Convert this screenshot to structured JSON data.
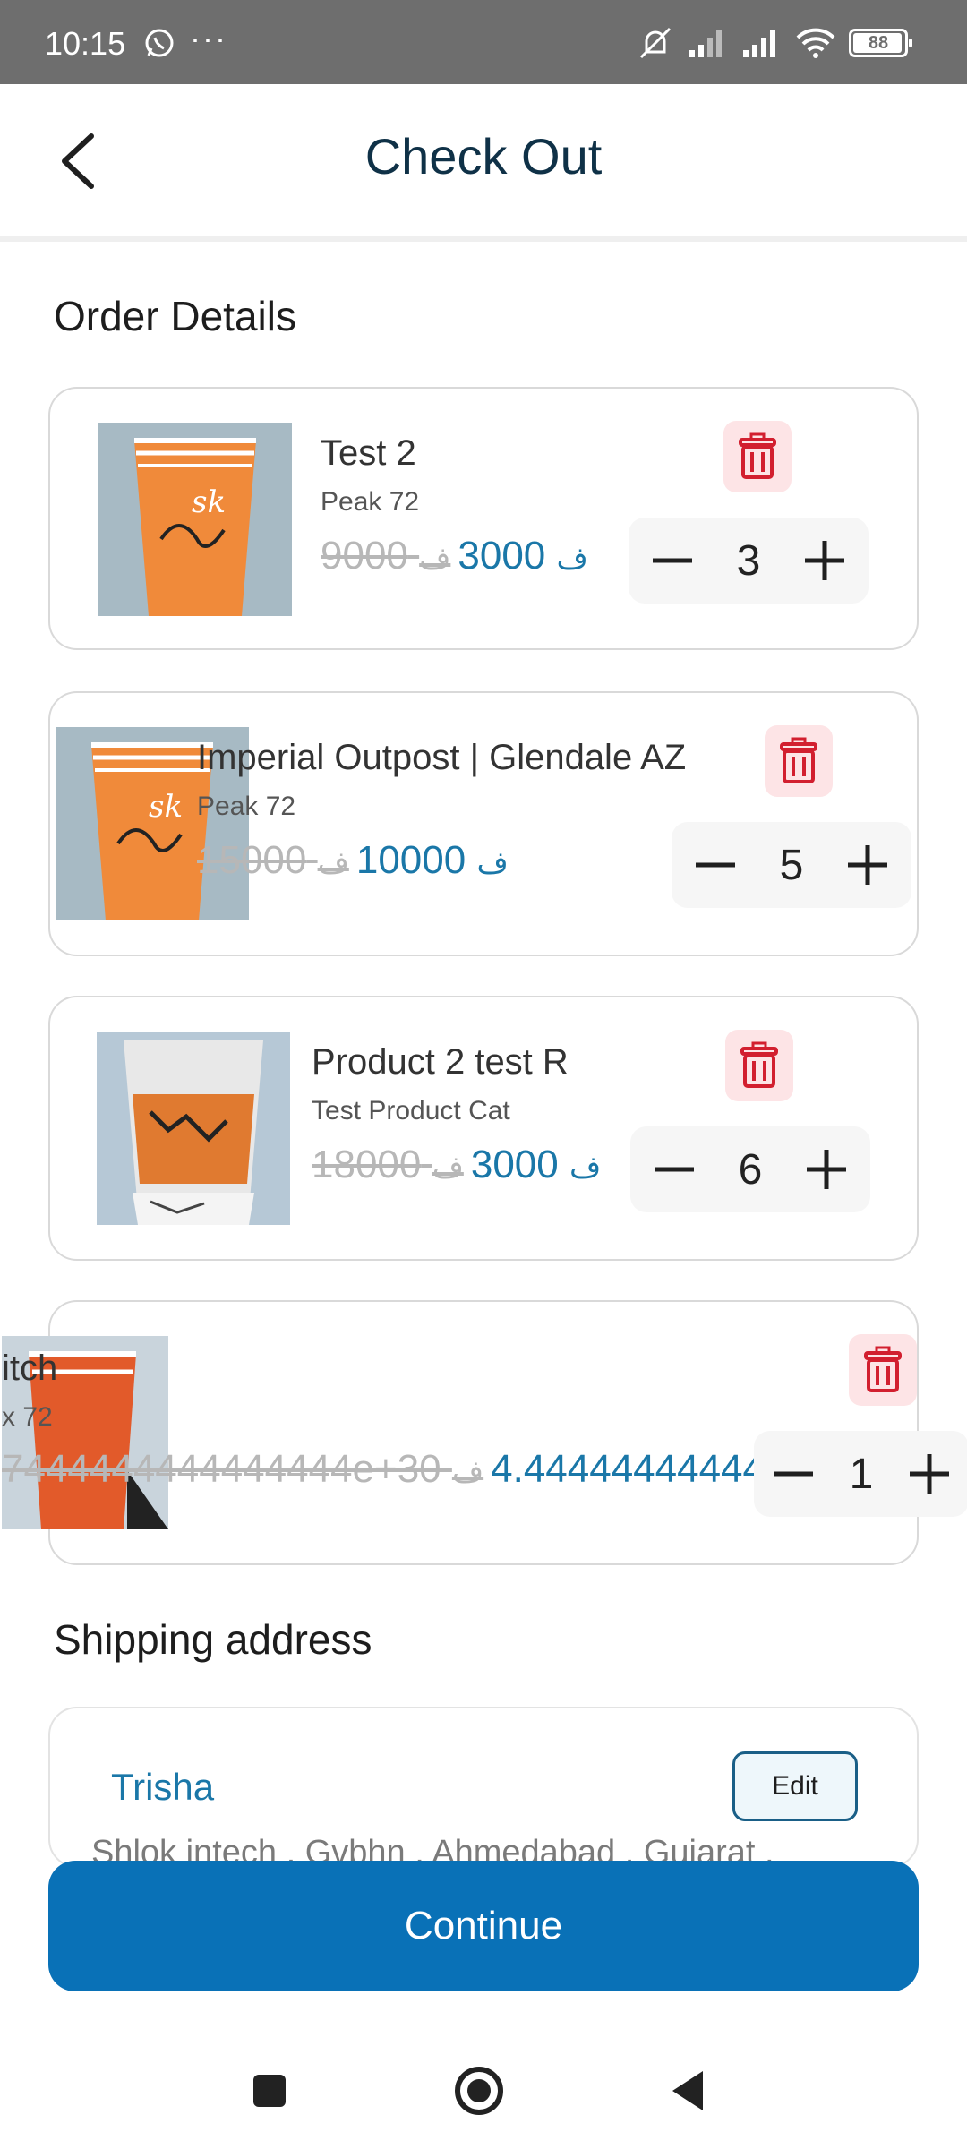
{
  "status_bar": {
    "time": "10:15",
    "more": "···",
    "battery": "88"
  },
  "header": {
    "title": "Check Out"
  },
  "order_details": {
    "title": "Order Details",
    "items": [
      {
        "name": "Test 2",
        "category": "Peak 72",
        "old_price": "9000",
        "new_price": "3000",
        "currency": "ﻑ",
        "quantity": "3"
      },
      {
        "name": "Imperial Outpost | Glendale AZ",
        "category": "Peak 72",
        "old_price": "15000",
        "new_price": "10000",
        "currency": "ﻑ",
        "quantity": "5"
      },
      {
        "name": "Product 2 test R",
        "category": "Test Product Cat",
        "old_price": "18000",
        "new_price": "3000",
        "currency": "ﻑ",
        "quantity": "6"
      },
      {
        "name": "itch",
        "category": "x 72",
        "old_price": "7444444444444444e+30",
        "new_price": "4.44444444444",
        "currency": "ﻑ",
        "quantity": "1"
      }
    ]
  },
  "shipping": {
    "title": "Shipping address",
    "name": "Trisha",
    "edit_label": "Edit",
    "address": "Shlok intech , Gvbhn , Ahmedabad , Gujarat ,"
  },
  "continue_label": "Continue",
  "colors": {
    "primary": "#0971b7",
    "price": "#1a77a8",
    "delete": "#d21f2f",
    "title": "#0f3147"
  }
}
